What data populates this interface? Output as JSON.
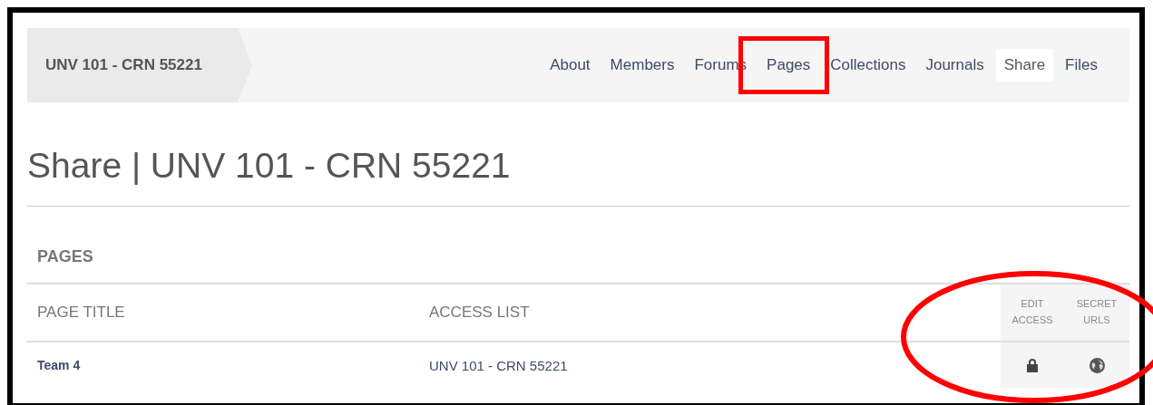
{
  "breadcrumb": "UNV 101 - CRN 55221",
  "nav": {
    "items": [
      {
        "label": "About",
        "selected": false,
        "circled": false
      },
      {
        "label": "Members",
        "selected": false,
        "circled": false
      },
      {
        "label": "Forums",
        "selected": false,
        "circled": false
      },
      {
        "label": "Pages",
        "selected": false,
        "circled": true
      },
      {
        "label": "Collections",
        "selected": false,
        "circled": false
      },
      {
        "label": "Journals",
        "selected": false,
        "circled": false
      },
      {
        "label": "Share",
        "selected": true,
        "circled": false
      },
      {
        "label": "Files",
        "selected": false,
        "circled": false
      }
    ]
  },
  "page_title": "Share | UNV 101 - CRN 55221",
  "section": {
    "heading": "PAGES"
  },
  "table": {
    "circled_access_columns": true,
    "columns": [
      "PAGE TITLE",
      "ACCESS LIST",
      "EDIT ACCESS",
      "SECRET URLS"
    ],
    "rows": [
      {
        "page_title": "Team 4",
        "access_list": "UNV 101 - CRN 55221"
      }
    ]
  }
}
